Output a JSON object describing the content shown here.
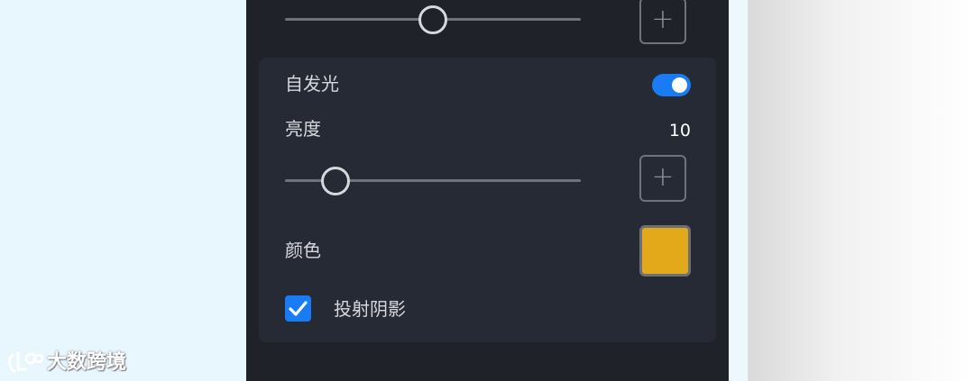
{
  "panel": {
    "top_slider": {
      "value_fraction": 0.5,
      "add_label": "+"
    },
    "emission": {
      "label": "自发光",
      "enabled": true,
      "brightness_label": "亮度",
      "brightness_value": "10",
      "brightness_slider_fraction": 0.17,
      "add_label": "+",
      "color_label": "颜色",
      "color_value": "#e3a91a"
    },
    "cast_shadow": {
      "label": "投射阴影",
      "checked": true
    }
  },
  "colors": {
    "accent": "#1a7cf5",
    "panel_bg": "#1f2229",
    "card_bg": "#262a34"
  },
  "watermark": {
    "text": "大数跨境"
  }
}
